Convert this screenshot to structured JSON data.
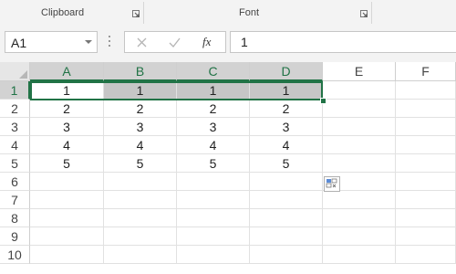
{
  "ribbon": {
    "groups": [
      {
        "label": "Clipboard"
      },
      {
        "label": "Font"
      }
    ]
  },
  "formula_bar": {
    "name_box_value": "A1",
    "formula_value": "1"
  },
  "grid": {
    "columns": [
      "A",
      "B",
      "C",
      "D",
      "E",
      "F"
    ],
    "rows": [
      "1",
      "2",
      "3",
      "4",
      "5",
      "6",
      "7",
      "8",
      "9",
      "10"
    ],
    "active_cell": "A1",
    "selected_range": "A1:D1",
    "cells": [
      [
        "1",
        "1",
        "1",
        "1",
        "",
        ""
      ],
      [
        "2",
        "2",
        "2",
        "2",
        "",
        ""
      ],
      [
        "3",
        "3",
        "3",
        "3",
        "",
        ""
      ],
      [
        "4",
        "4",
        "4",
        "4",
        "",
        ""
      ],
      [
        "5",
        "5",
        "5",
        "5",
        "",
        ""
      ],
      [
        "",
        "",
        "",
        "",
        "",
        ""
      ],
      [
        "",
        "",
        "",
        "",
        "",
        ""
      ],
      [
        "",
        "",
        "",
        "",
        "",
        ""
      ],
      [
        "",
        "",
        "",
        "",
        "",
        ""
      ],
      [
        "",
        "",
        "",
        "",
        "",
        ""
      ]
    ]
  },
  "colors": {
    "accent": "#217346",
    "selection_fill": "#c6c6c6",
    "header_selected": "#d2d2d2"
  }
}
